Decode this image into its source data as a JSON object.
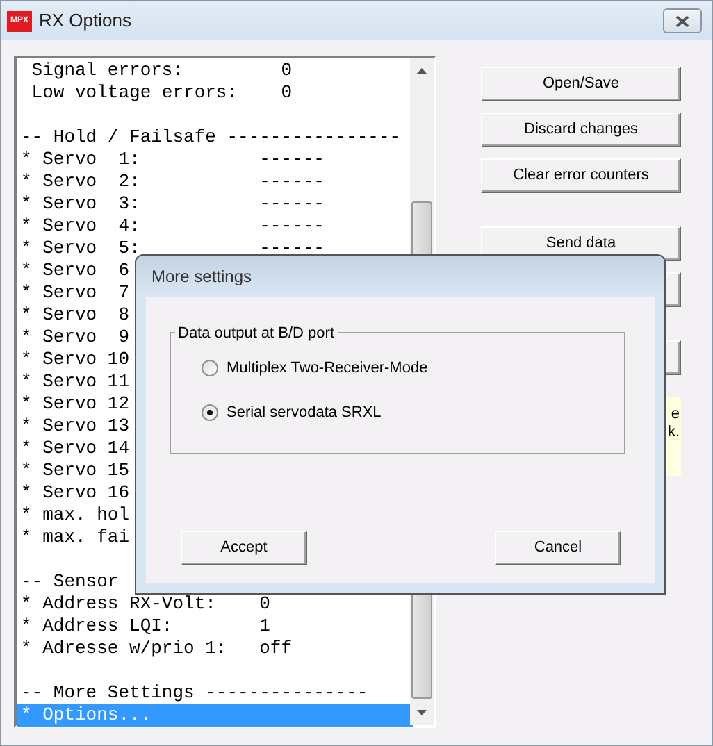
{
  "window": {
    "title": "RX Options",
    "logo": "MPX"
  },
  "list": {
    "lines": [
      {
        "text": " Signal errors:         0",
        "selected": false
      },
      {
        "text": " Low voltage errors:    0",
        "selected": false
      },
      {
        "selected": false
      },
      {
        "text": "-- Hold / Failsafe ----------------",
        "selected": false
      },
      {
        "text": "* Servo  1:           ------",
        "selected": false
      },
      {
        "text": "* Servo  2:           ------",
        "selected": false
      },
      {
        "text": "* Servo  3:           ------",
        "selected": false
      },
      {
        "text": "* Servo  4:           ------",
        "selected": false
      },
      {
        "text": "* Servo  5:           ------",
        "selected": false
      },
      {
        "text": "* Servo  6",
        "selected": false
      },
      {
        "text": "* Servo  7",
        "selected": false
      },
      {
        "text": "* Servo  8",
        "selected": false
      },
      {
        "text": "* Servo  9",
        "selected": false
      },
      {
        "text": "* Servo 10",
        "selected": false
      },
      {
        "text": "* Servo 11",
        "selected": false
      },
      {
        "text": "* Servo 12",
        "selected": false
      },
      {
        "text": "* Servo 13",
        "selected": false
      },
      {
        "text": "* Servo 14",
        "selected": false
      },
      {
        "text": "* Servo 15",
        "selected": false
      },
      {
        "text": "* Servo 16",
        "selected": false
      },
      {
        "text": "* max. hol",
        "selected": false
      },
      {
        "text": "* max. fai",
        "selected": false
      },
      {
        "selected": false
      },
      {
        "text": "-- Sensor",
        "selected": false
      },
      {
        "text": "* Address RX-Volt:    0",
        "selected": false
      },
      {
        "text": "* Address LQI:        1",
        "selected": false
      },
      {
        "text": "* Adresse w/prio 1:   off",
        "selected": false
      },
      {
        "selected": false
      },
      {
        "text": "-- More Settings ---------------",
        "selected": false
      },
      {
        "text": "* Options...",
        "selected": true
      }
    ]
  },
  "buttons": [
    {
      "kind": "labeled",
      "label": "Open/Save"
    },
    {
      "kind": "labeled",
      "label": "Discard changes"
    },
    {
      "kind": "labeled",
      "label": "Clear error counters"
    },
    {
      "kind": "labeled",
      "label": "Send data"
    },
    {
      "kind": "blank"
    },
    {
      "kind": "blank"
    }
  ],
  "note": {
    "lines": [
      "e",
      "k."
    ]
  },
  "dialog": {
    "title": "More settings",
    "group": {
      "legend": "Data output at B/D port",
      "options": [
        {
          "label": "Multiplex Two-Receiver-Mode",
          "selected": false
        },
        {
          "label": "Serial servodata SRXL",
          "selected": true
        }
      ]
    },
    "buttons": [
      "Accept",
      "Cancel"
    ]
  }
}
